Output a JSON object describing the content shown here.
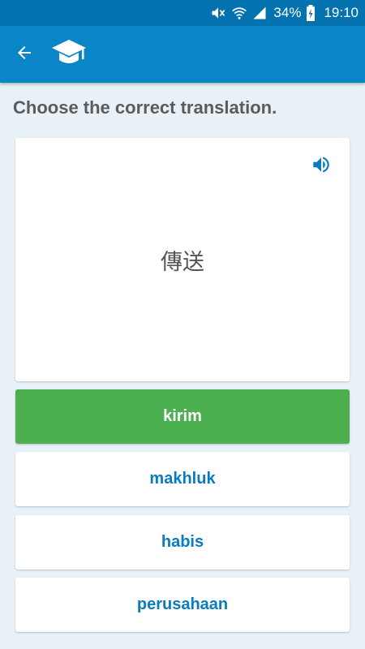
{
  "status_bar": {
    "battery_percent": "34%",
    "time": "19:10",
    "icons": [
      "mute-icon",
      "wifi-icon",
      "signal-icon",
      "battery-charging-icon"
    ]
  },
  "app_bar": {
    "back_icon": "arrow-left-icon",
    "logo_icon": "graduation-cap-icon",
    "color": "#0a86c8"
  },
  "quiz": {
    "prompt": "Choose the correct translation.",
    "question": "傳送",
    "speaker_icon": "speaker-icon",
    "answers": [
      "kirim",
      "makhluk",
      "habis",
      "perusahaan"
    ],
    "correct_answer": "kirim"
  },
  "colors": {
    "accent": "#0a7bbd",
    "correct": "#4caf50",
    "background": "#e8f1f8"
  }
}
